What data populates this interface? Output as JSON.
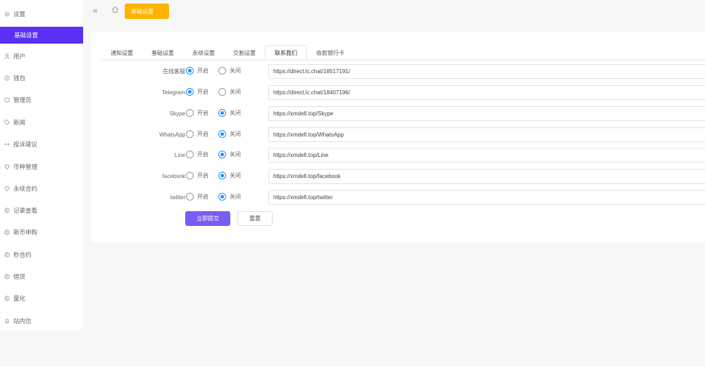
{
  "sidebar": {
    "settings": {
      "label": "设置",
      "icon": "gear-icon"
    },
    "basic_settings": {
      "label": "基础设置"
    },
    "items": [
      {
        "label": "用户",
        "icon": "user-icon"
      },
      {
        "label": "钱包",
        "icon": "wallet-icon"
      },
      {
        "label": "管理员",
        "icon": "shield-icon"
      },
      {
        "label": "新闻",
        "icon": "tag-icon"
      },
      {
        "label": "投诉建议",
        "icon": "link-icon"
      },
      {
        "label": "币种管理",
        "icon": "diamond-icon"
      },
      {
        "label": "永续合约",
        "icon": "diamond-icon"
      },
      {
        "label": "记录查看",
        "icon": "coin-icon"
      },
      {
        "label": "新币申购",
        "icon": "coin-icon"
      },
      {
        "label": "秒合约",
        "icon": "coin-icon"
      },
      {
        "label": "借贷",
        "icon": "coin-icon"
      },
      {
        "label": "量化",
        "icon": "coin-icon"
      },
      {
        "label": "站内信",
        "icon": "bell-icon"
      }
    ]
  },
  "topbar": {
    "collapse_glyph": "«",
    "tag_label": "基础设置"
  },
  "tabs": [
    "通知设置",
    "基础设置",
    "永续设置",
    "交割设置",
    "联系我们",
    "收款银行卡"
  ],
  "active_tab": "联系我们",
  "radio_labels": {
    "on": "开启",
    "off": "关闭"
  },
  "contacts": [
    {
      "label": "在线客服",
      "enabled": true,
      "url": "https://direct.lc.chat/18517191/"
    },
    {
      "label": "Telegram",
      "enabled": true,
      "url": "https://direct.lc.chat/18407196/"
    },
    {
      "label": "Skype",
      "enabled": false,
      "url": "https://xmdefi.top/Skype"
    },
    {
      "label": "WhatsApp",
      "enabled": false,
      "url": "https://xmdefi.top/WhatsApp"
    },
    {
      "label": "Line",
      "enabled": false,
      "url": "https://xmdefi.top/Line"
    },
    {
      "label": "facebook",
      "enabled": false,
      "url": "https://xmdefi.top/facebook"
    },
    {
      "label": "twitter",
      "enabled": false,
      "url": "https://xmdefi.top/twitter"
    }
  ],
  "buttons": {
    "submit": "立即提交",
    "reset": "重置"
  },
  "colors": {
    "accent": "#5a31f4",
    "tag": "#ffb400",
    "radio_on": "#1e90ff",
    "submit": "#7b5cf0"
  }
}
